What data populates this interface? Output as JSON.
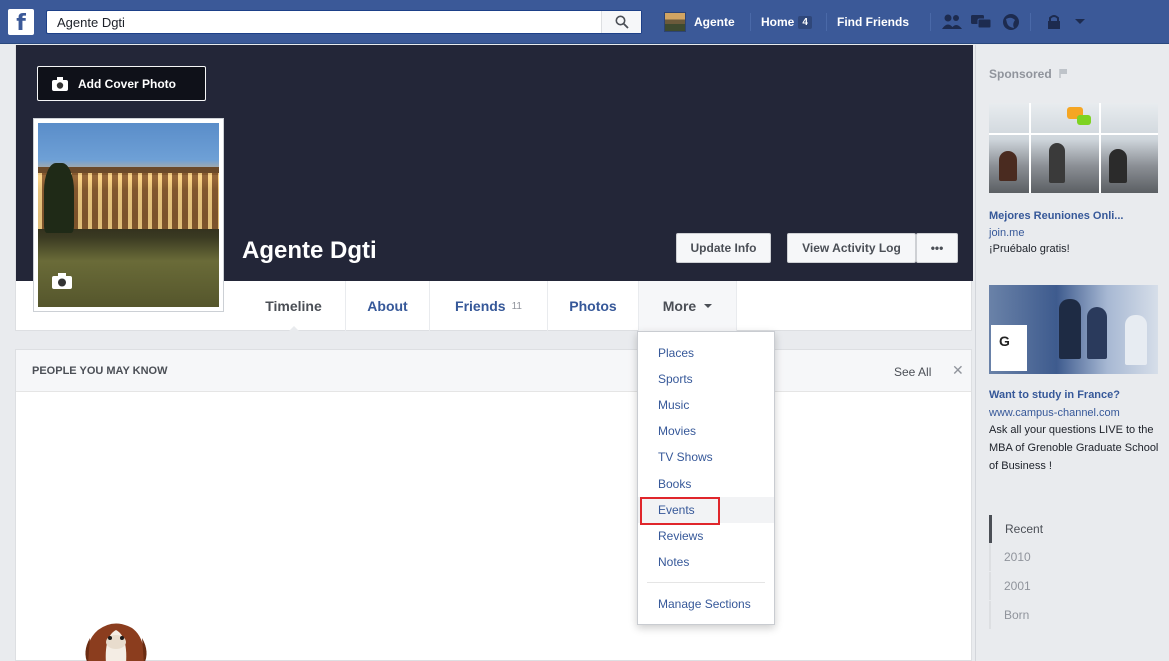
{
  "topbar": {
    "search_value": "Agente Dgti",
    "user_name": "Agente",
    "home_label": "Home",
    "home_count": "4",
    "find_friends_label": "Find Friends"
  },
  "profile": {
    "name": "Agente Dgti",
    "add_cover_label": "Add Cover Photo",
    "update_info_label": "Update Info",
    "activity_log_label": "View Activity Log",
    "more_actions_label": "•••"
  },
  "tabs": [
    {
      "label": "Timeline"
    },
    {
      "label": "About"
    },
    {
      "label": "Friends",
      "count": "11"
    },
    {
      "label": "Photos"
    },
    {
      "label": "More"
    }
  ],
  "more_menu": {
    "items": [
      "Places",
      "Sports",
      "Music",
      "Movies",
      "TV Shows",
      "Books",
      "Events",
      "Reviews",
      "Notes"
    ],
    "highlighted": "Events",
    "manage_label": "Manage Sections"
  },
  "pymk": {
    "title": "PEOPLE YOU MAY KNOW",
    "see_all": "See All",
    "close": "✕"
  },
  "sidebar": {
    "sponsored_label": "Sponsored",
    "ads": [
      {
        "title": "Mejores Reuniones Onli...",
        "domain": "join.me",
        "text": "¡Pruébalo gratis!"
      },
      {
        "title": "Want to study in France?",
        "domain": "www.campus-channel.com",
        "text": "Ask all your questions LIVE to the MBA of Grenoble Graduate School of Business !"
      }
    ],
    "years": [
      "Recent",
      "2010",
      "2001",
      "Born"
    ]
  },
  "colors": {
    "brand_blue": "#3b5998",
    "cover_dark": "#232638",
    "link_blue": "#365899",
    "highlight_red": "#e0262b"
  }
}
